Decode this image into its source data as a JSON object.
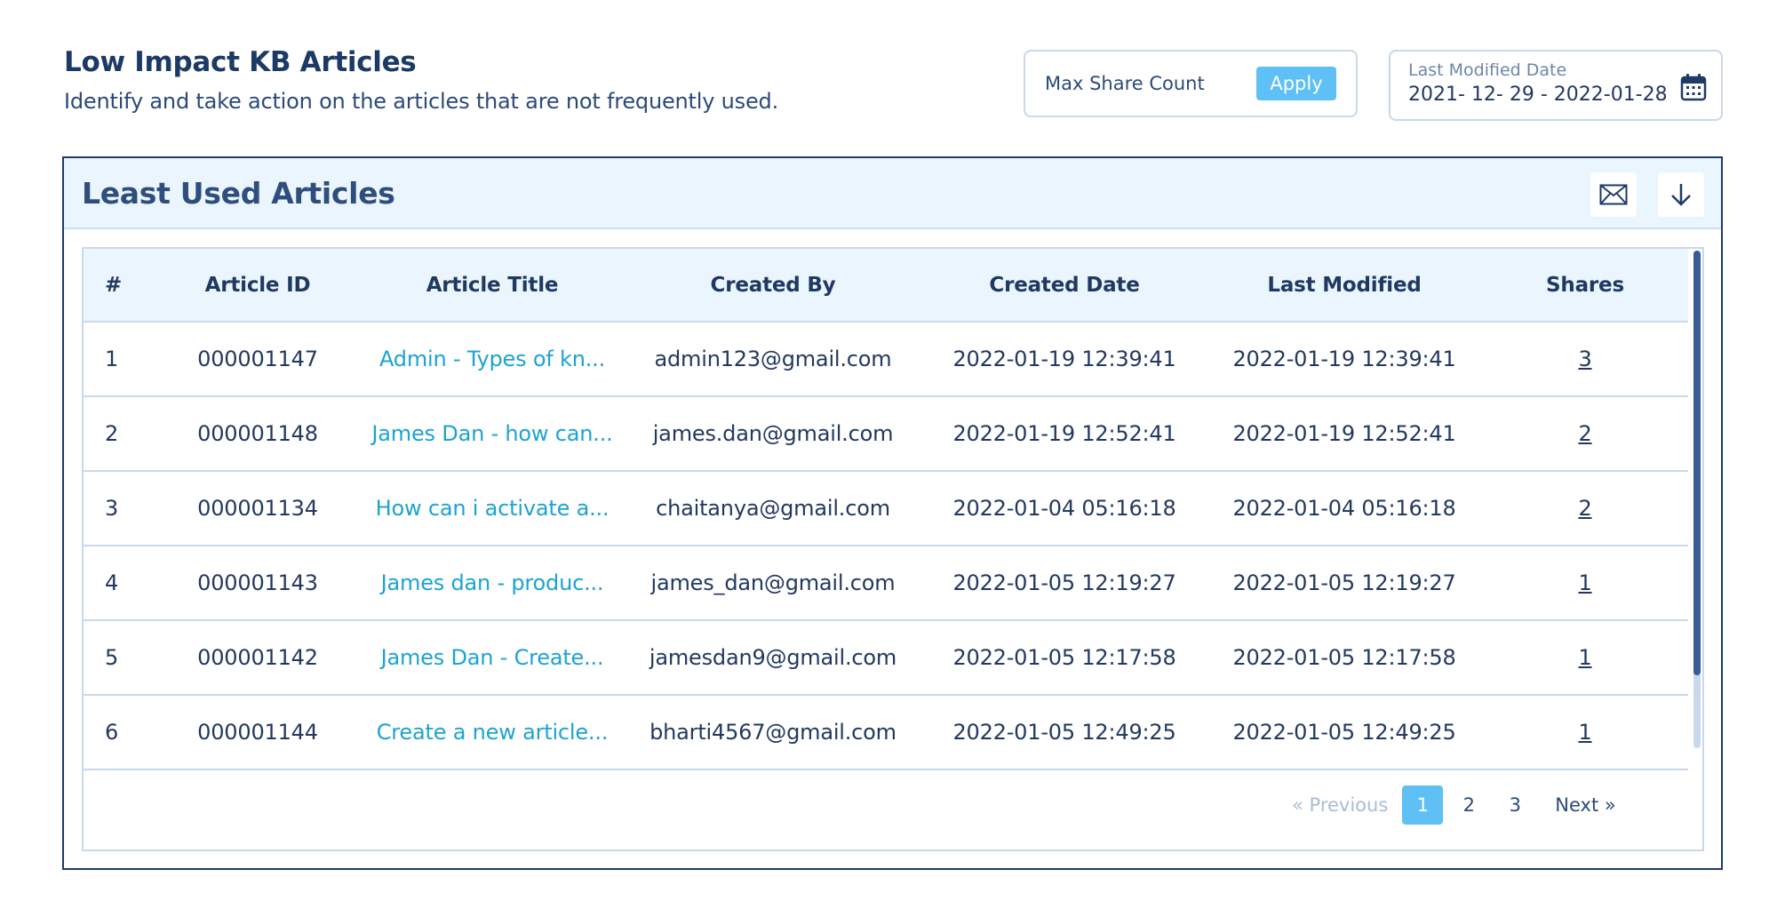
{
  "header": {
    "title": "Low Impact KB Articles",
    "subtitle": "Identify and take action on the articles that are not frequently used."
  },
  "filters": {
    "share_count_label": "Max Share Count",
    "apply_label": "Apply",
    "date_label": "Last Modified Date",
    "date_value": "2021- 12- 29 - 2022-01-28"
  },
  "panel": {
    "title": "Least Used Articles",
    "icons": [
      "mail-icon",
      "download-icon"
    ]
  },
  "table": {
    "columns": [
      "#",
      "Article ID",
      "Article Title",
      "Created By",
      "Created Date",
      "Last Modified",
      "Shares"
    ],
    "rows": [
      {
        "num": "1",
        "id": "000001147",
        "title": "Admin - Types of kn...",
        "created_by": "admin123@gmail.com",
        "created_date": "2022-01-19  12:39:41",
        "last_modified": "2022-01-19  12:39:41",
        "shares": "3"
      },
      {
        "num": "2",
        "id": "000001148",
        "title": "James Dan - how can...",
        "created_by": "james.dan@gmail.com",
        "created_date": "2022-01-19  12:52:41",
        "last_modified": "2022-01-19  12:52:41",
        "shares": "2"
      },
      {
        "num": "3",
        "id": "000001134",
        "title": "How can i activate a...",
        "created_by": "chaitanya@gmail.com",
        "created_date": "2022-01-04  05:16:18",
        "last_modified": "2022-01-04  05:16:18",
        "shares": "2"
      },
      {
        "num": "4",
        "id": "000001143",
        "title": "James dan - produc...",
        "created_by": "james_dan@gmail.com",
        "created_date": "2022-01-05  12:19:27",
        "last_modified": "2022-01-05  12:19:27",
        "shares": "1"
      },
      {
        "num": "5",
        "id": "000001142",
        "title": "James Dan - Create...",
        "created_by": "jamesdan9@gmail.com",
        "created_date": "2022-01-05  12:17:58",
        "last_modified": "2022-01-05  12:17:58",
        "shares": "1"
      },
      {
        "num": "6",
        "id": "000001144",
        "title": "Create a new article...",
        "created_by": "bharti4567@gmail.com",
        "created_date": "2022-01-05  12:49:25",
        "last_modified": "2022-01-05  12:49:25",
        "shares": "1"
      }
    ]
  },
  "pagination": {
    "previous_label": "«  Previous",
    "pages": [
      "1",
      "2",
      "3"
    ],
    "current_page": "1",
    "next_label": "Next  »"
  },
  "colors": {
    "accent": "#5ec0f5",
    "link": "#1da3d1",
    "header_bg": "#eaf5fd",
    "border_dark": "#1d3b66"
  }
}
